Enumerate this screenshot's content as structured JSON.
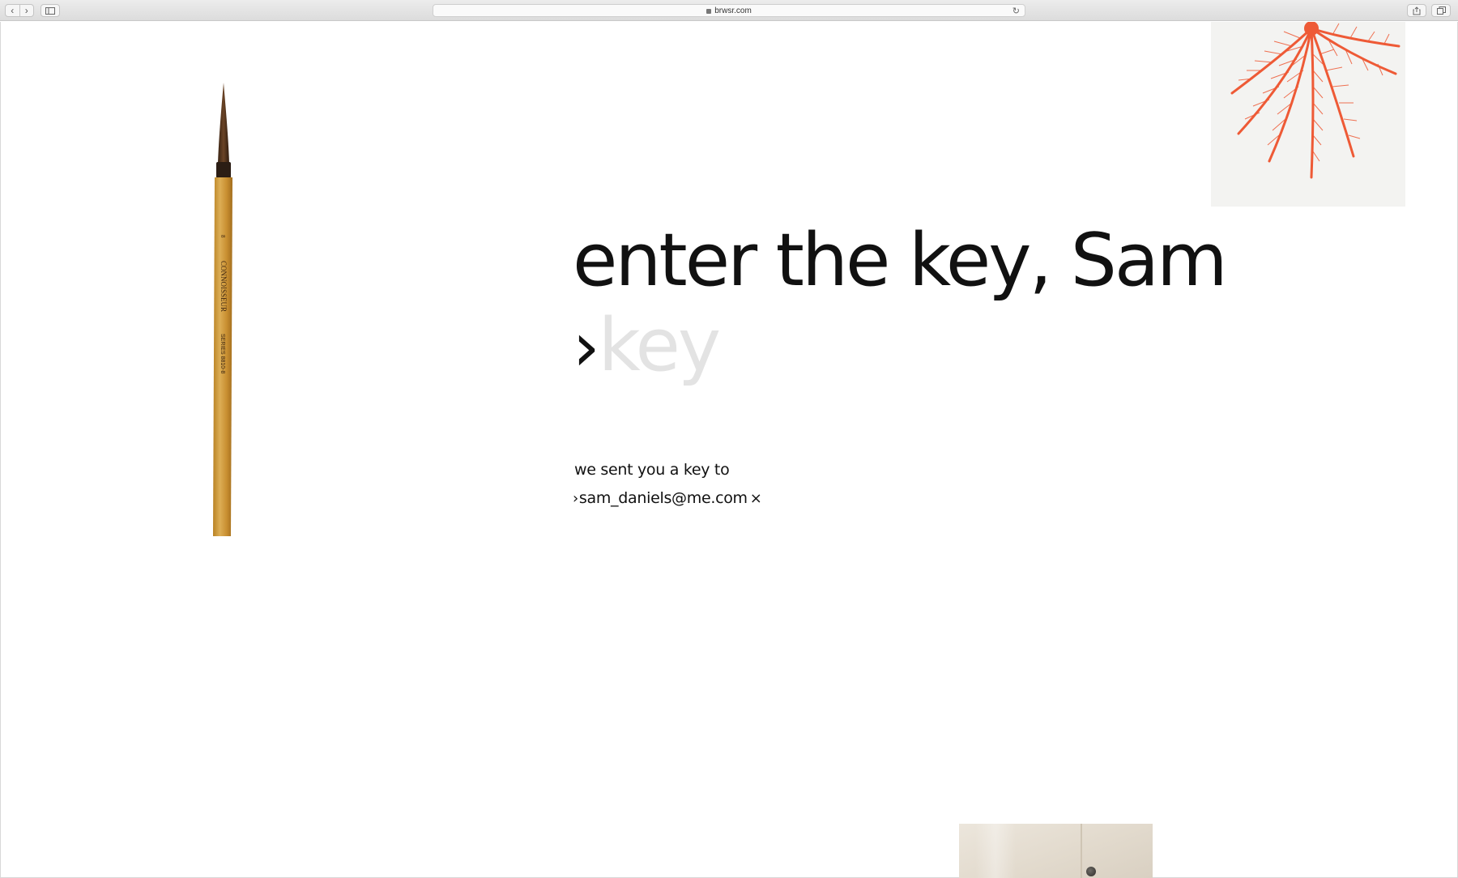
{
  "browser": {
    "url": "brwsr.com",
    "back_glyph": "‹",
    "forward_glyph": "›",
    "reload_glyph": "↻"
  },
  "main": {
    "title": "enter the key, Sam",
    "prompt_glyph": "›",
    "key_placeholder": "key",
    "sent_text": "we sent you a key to",
    "email_arrow": "›",
    "email": "sam_daniels@me.com",
    "clear_glyph": "×"
  },
  "brush_label": {
    "brand": "CONNOISSEUR",
    "series": "SERIES 8810-8",
    "size": "8"
  },
  "colors": {
    "accent": "#ee5a36",
    "text": "#111111",
    "placeholder": "#e3e3e3",
    "brush_wood": "#cf9a3a"
  }
}
